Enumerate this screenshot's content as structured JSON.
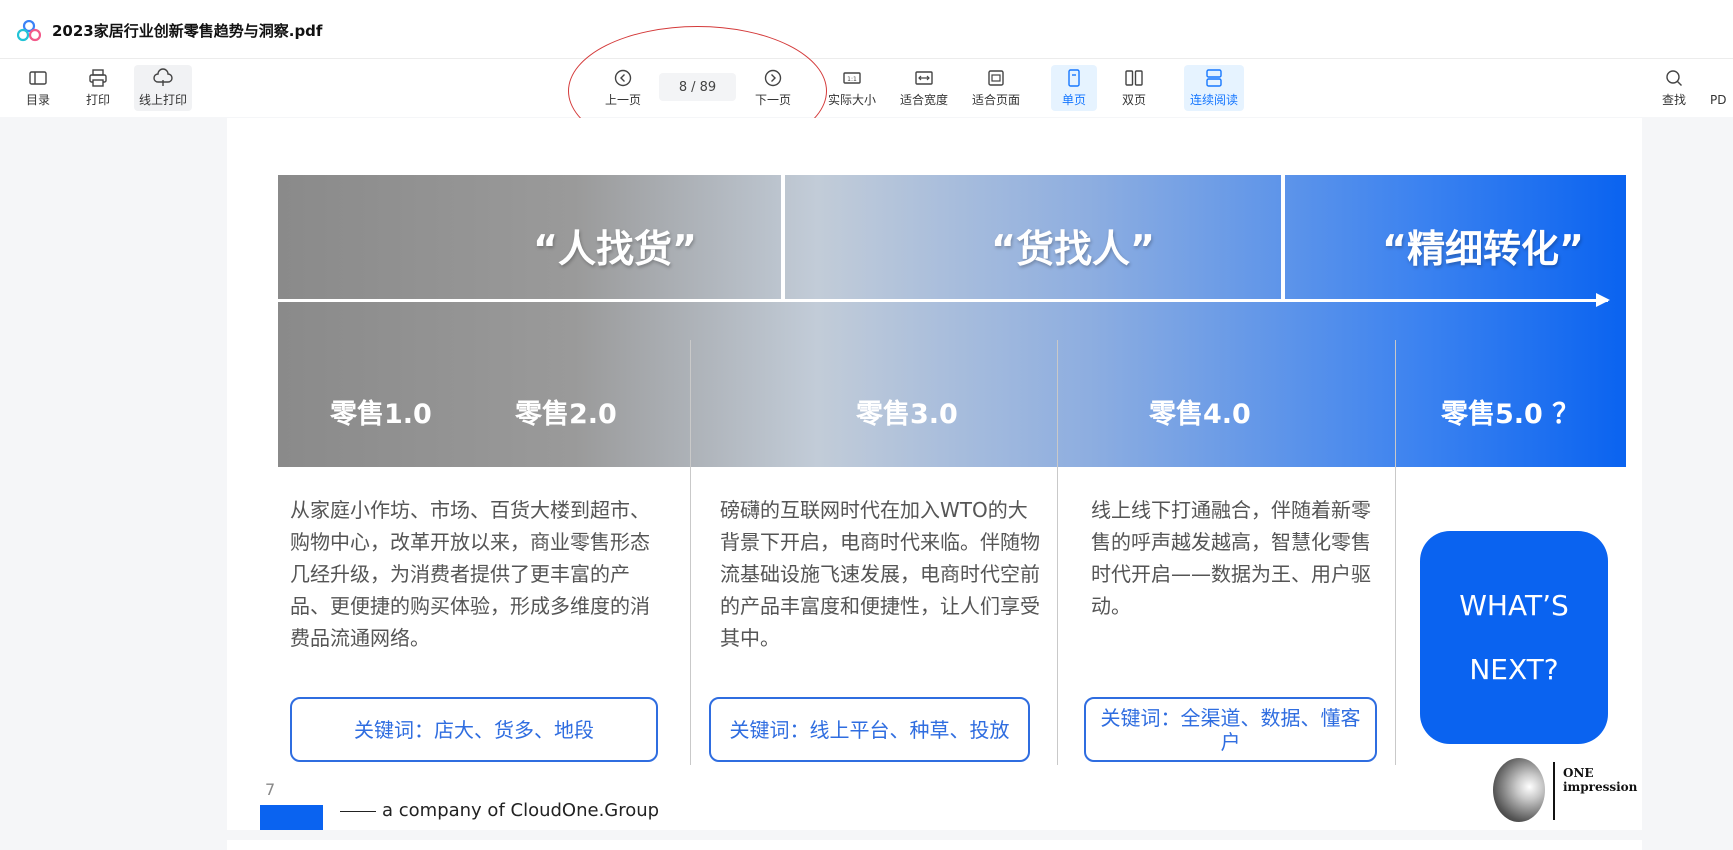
{
  "titlebar": {
    "logo_icon": "app-logo-icon",
    "document_title": "2023家居行业创新零售趋势与洞察.pdf"
  },
  "toolbar": {
    "toc_label": "目录",
    "print_label": "打印",
    "online_print_label": "线上打印",
    "prev_label": "上一页",
    "current_page": "8",
    "total_pages": "/ 89",
    "next_label": "下一页",
    "actual_size_label": "实际大小",
    "fit_width_label": "适合宽度",
    "fit_page_label": "适合页面",
    "single_page_label": "单页",
    "double_page_label": "双页",
    "continuous_label": "连续阅读",
    "find_label": "查找",
    "pdf_label": "PD",
    "accent_color": "#1677ff",
    "annotation_color": "#d43a3a"
  },
  "slide": {
    "slogans": [
      "“人找货”",
      "“货找人”",
      "“精细转化”"
    ],
    "stages": [
      "零售1.0",
      "零售2.0",
      "零售3.0",
      "零售4.0",
      "零售5.0 ？"
    ],
    "descriptions": [
      "从家庭小作坊、市场、百货大楼到超市、购物中心，改革开放以来，商业零售形态几经升级，为消费者提供了更丰富的产品、更便捷的购买体验，形成多维度的消费品流通网络。",
      "磅礴的互联网时代在加入WTO的大背景下开启，电商时代来临。伴随物流基础设施飞速发展，电商时代空前的产品丰富度和便捷性，让人们享受其中。",
      "线上线下打通融合，伴随着新零售的呼声越发越高，智慧化零售时代开启——数据为王、用户驱动。"
    ],
    "keywords": [
      "关键词：店大、货多、地段",
      "关键词：线上平台、种草、投放",
      "关键词：全渠道、数据、懂客户"
    ],
    "whats_next_line1": "WHAT’S",
    "whats_next_line2": "NEXT?",
    "page_number": "7",
    "company_text": "a company of CloudOne.Group",
    "brand_line1": "ONE",
    "brand_line2": "impression",
    "brand_blue": "#0a63f0"
  }
}
